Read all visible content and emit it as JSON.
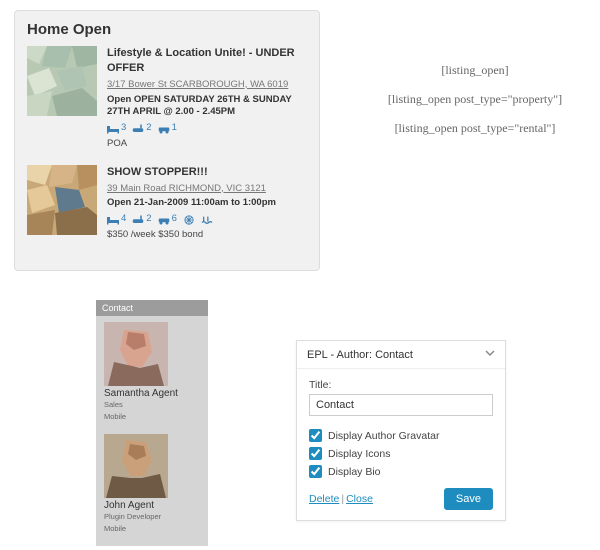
{
  "home_open": {
    "title": "Home Open",
    "listings": [
      {
        "title": "Lifestyle & Location Unite! - UNDER OFFER",
        "address": "3/17 Bower St SCARBOROUGH, WA 6019",
        "open": "Open OPEN SATURDAY 26TH & SUNDAY 27TH APRIL @ 2.00 - 2.45PM",
        "beds": "3",
        "baths": "2",
        "cars": "1",
        "price": "POA"
      },
      {
        "title": "SHOW STOPPER!!!",
        "address": "39 Main Road RICHMOND, VIC 3121",
        "open": "Open 21-Jan-2009 11:00am to 1:00pm",
        "beds": "4",
        "baths": "2",
        "cars": "6",
        "price": "$350 /week $350 bond"
      }
    ]
  },
  "shortcodes": {
    "a": "[listing_open]",
    "b": "[listing_open post_type=\"property\"]",
    "c": "[listing_open post_type=\"rental\"]"
  },
  "contact_widget": {
    "header": "Contact",
    "agents": [
      {
        "name": "Samantha Agent",
        "role": "Sales",
        "phone": "Mobile"
      },
      {
        "name": "John Agent",
        "role": "Plugin Developer",
        "phone": "Mobile"
      }
    ]
  },
  "epl": {
    "header": "EPL - Author: Contact",
    "title_label": "Title:",
    "title_value": "Contact",
    "chk_gravatar": "Display Author Gravatar",
    "chk_icons": "Display Icons",
    "chk_bio": "Display Bio",
    "delete": "Delete",
    "close": "Close",
    "save": "Save"
  }
}
